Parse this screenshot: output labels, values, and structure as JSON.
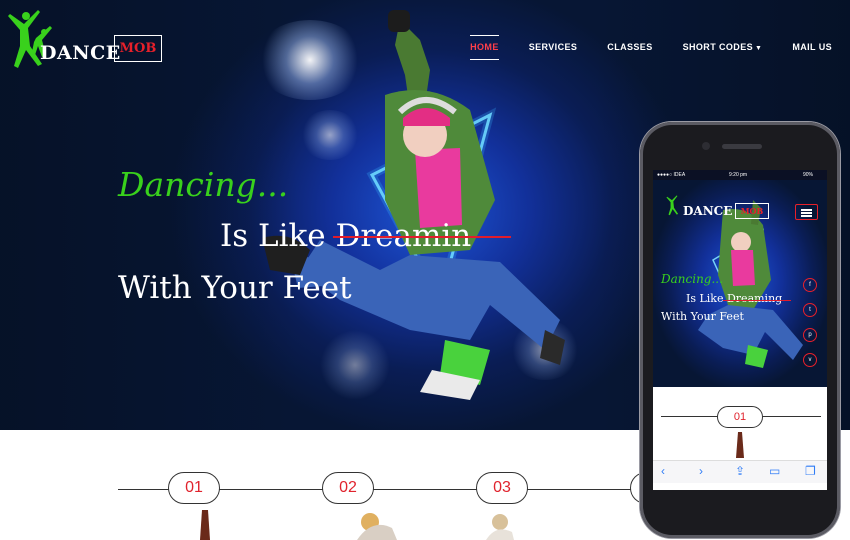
{
  "brand": {
    "name": "DANCE",
    "badge": "MOB"
  },
  "nav": [
    {
      "label": "HOME",
      "active": true
    },
    {
      "label": "SERVICES",
      "active": false
    },
    {
      "label": "CLASSES",
      "active": false
    },
    {
      "label": "SHORT CODES",
      "active": false,
      "has_dropdown": true
    },
    {
      "label": "MAIL US",
      "active": false
    }
  ],
  "hero": {
    "line1": "Dancing...",
    "line2": "Is Like Dreamin",
    "line3": "With Your Feet"
  },
  "steps": [
    "01",
    "02",
    "03"
  ],
  "phone": {
    "status": {
      "carrier": "●●●●○ IDEA",
      "time": "9:20 pm",
      "battery": "90%"
    },
    "brand": {
      "name": "DANCE",
      "badge": "MOB"
    },
    "hero": {
      "line1": "Dancing...",
      "line2": "Is Like Dreaming",
      "line3": "With Your Feet"
    },
    "social": [
      "f",
      "t",
      "p",
      "v"
    ],
    "step": "01",
    "toolbar_icons": [
      "back-icon",
      "forward-icon",
      "share-icon",
      "bookmarks-icon",
      "tabs-icon"
    ]
  },
  "colors": {
    "accent": "#e8202a",
    "green": "#39d11c",
    "hero_bg": "#0a1d55"
  }
}
